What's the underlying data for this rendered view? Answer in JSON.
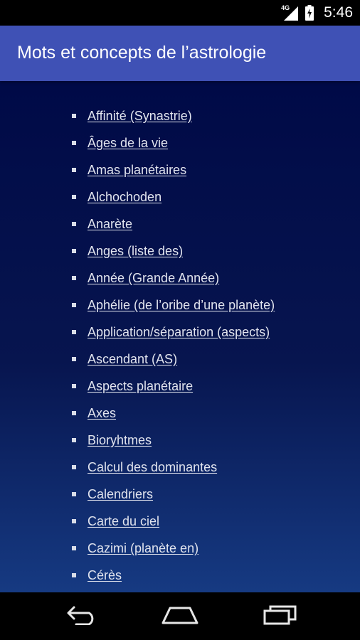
{
  "status_bar": {
    "network_label": "4G",
    "time": "5:46",
    "icons": [
      "signal-icon",
      "battery-charging-icon"
    ]
  },
  "app_bar": {
    "title": "Mots et concepts de l’astrologie",
    "color": "#3f51b5"
  },
  "terms": [
    "Affinité (Synastrie)",
    "Âges de la vie",
    "Amas planétaires",
    "Alchochoden",
    "Anarète",
    "Anges (liste des)",
    "Année (Grande Année)",
    "Aphélie (de l’oribe d’une planète)",
    "Application/séparation (aspects)",
    "Ascendant (AS)",
    "Aspects planétaire",
    "Axes",
    "Bioryhtmes",
    "Calcul des dominantes",
    "Calendriers",
    "Carte du ciel",
    "Cazimi (planète en)",
    "Cérès"
  ],
  "nav_bar": {
    "buttons": [
      "back-icon",
      "home-icon",
      "recents-icon"
    ]
  }
}
